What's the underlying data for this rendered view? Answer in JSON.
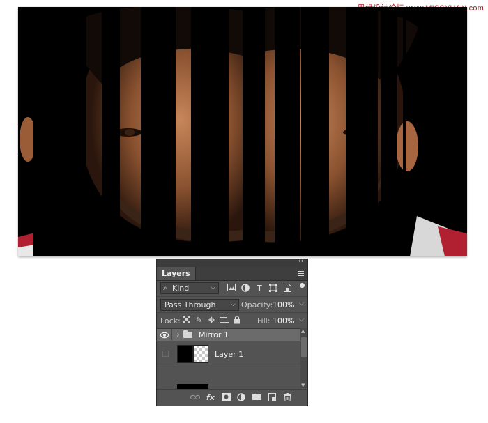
{
  "watermark": "思缘设计论坛 www.MISSYUAN.com",
  "photo": {
    "strip_count": 10
  },
  "layers_panel": {
    "tab_label": "Layers",
    "collapse_glyph": "‹‹",
    "filter_kind": "Kind",
    "blend_mode": "Pass Through",
    "opacity_label": "Opacity:",
    "opacity_value": "100%",
    "lock_label": "Lock:",
    "fill_label": "Fill:",
    "fill_value": "100%",
    "layers": [
      {
        "name": "Mirror 1",
        "type": "group",
        "visible": true,
        "selected": true
      },
      {
        "name": "Layer 1",
        "type": "pixel",
        "visible": false,
        "selected": false
      }
    ],
    "icons": {
      "filter": [
        "image-filter-icon",
        "adjustment-filter-icon",
        "type-filter-icon",
        "shape-filter-icon",
        "smart-object-filter-icon"
      ],
      "lock": [
        "lock-transparent-pixels-icon",
        "lock-image-pixels-icon",
        "lock-position-icon",
        "lock-artboard-icon",
        "lock-all-icon"
      ],
      "bottom": [
        "link-layers-icon",
        "layer-style-icon",
        "layer-mask-icon",
        "adjustment-layer-icon",
        "new-group-icon",
        "new-layer-icon",
        "delete-layer-icon"
      ]
    },
    "fx_label": "fx"
  }
}
